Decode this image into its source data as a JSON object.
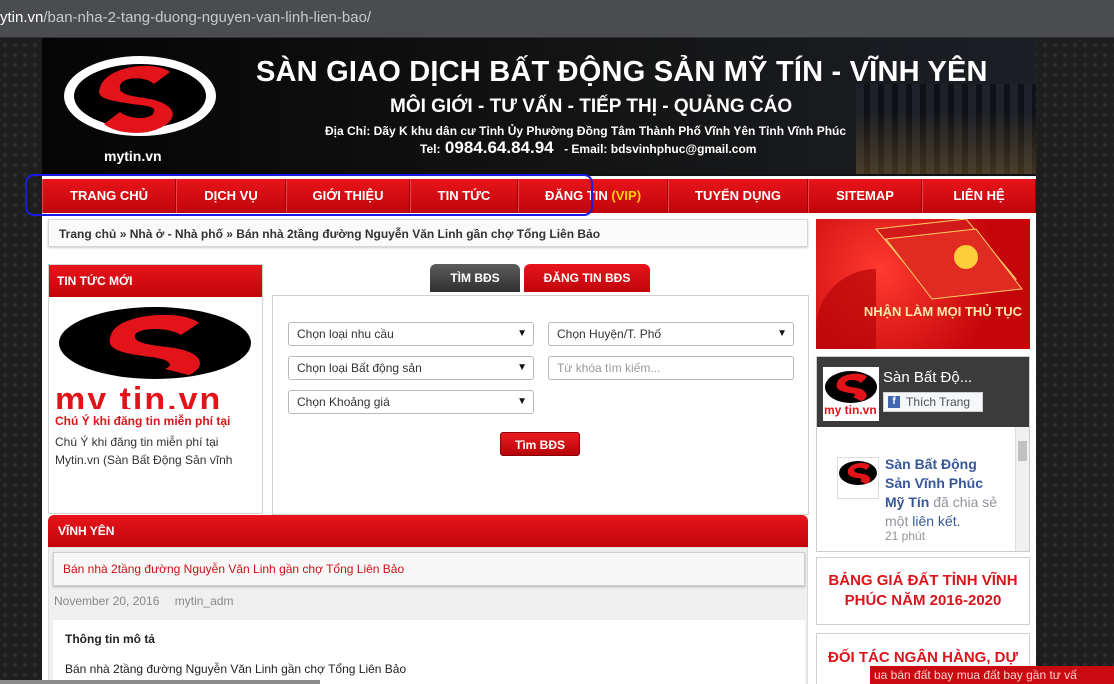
{
  "browser": {
    "url_host": "ytin.vn",
    "url_path": "/ban-nha-2-tang-duong-nguyen-van-linh-lien-bao/"
  },
  "banner": {
    "logo_text": "mytin.vn",
    "title": "SÀN GIAO DỊCH BẤT ĐỘNG SẢN MỸ TÍN - VĨNH YÊN",
    "subtitle": "MÔI GIỚI - TƯ VẤN - TIẾP THỊ - QUẢNG CÁO",
    "address": "Địa Chỉ: Dãy K khu dân cư Tỉnh Ủy Phường Đồng Tâm Thành Phố Vĩnh Yên Tỉnh Vĩnh Phúc",
    "tel_label": "Tel:",
    "phone": "0984.64.84.94",
    "email": "- Email: bdsvinhphuc@gmail.com"
  },
  "nav": {
    "items": [
      {
        "label": "TRANG CHỦ"
      },
      {
        "label": "DỊCH VỤ"
      },
      {
        "label": "GIỚI THIỆU"
      },
      {
        "label": "TIN TỨC"
      },
      {
        "label": "ĐĂNG TIN",
        "suffix": "(VIP)"
      },
      {
        "label": "TUYỂN DỤNG"
      },
      {
        "label": "SITEMAP"
      },
      {
        "label": "LIÊN HỆ"
      }
    ]
  },
  "breadcrumb": {
    "home": "Trang chủ",
    "sep": "»",
    "category": "Nhà ở - Nhà phố",
    "current": "Bán nhà 2tầng đường Nguyễn Văn Linh gần chợ Tổng Liên Bảo"
  },
  "news_box": {
    "heading": "TIN TỨC MỚI",
    "image_text": "my tin.vn",
    "item_title": "Chú Ý khi đăng tin miễn phí tại",
    "item_desc": "Chú Ý khi đăng tin miễn phí tại Mytin.vn (Sàn Bất Động Sản vĩnh"
  },
  "search": {
    "tab_search": "TÌM BĐS",
    "tab_post": "ĐĂNG TIN BĐS",
    "need": "Chọn loại nhu cầu",
    "district": "Chọn Huyện/T. Phố",
    "type": "Chọn loại Bất động sản",
    "keyword_placeholder": "Từ khóa tìm kiếm...",
    "price": "Chọn Khoảng giá",
    "button": "Tìm BĐS"
  },
  "section": {
    "heading": "VĨNH YÊN",
    "post_title": "Bán nhà 2tầng đường Nguyễn Văn Linh gần chợ Tổng Liên Bảo",
    "date": "November 20, 2016",
    "author": "mytin_adm",
    "desc_heading": "Thông tin mô tả",
    "desc_text": "Bán nhà 2tầng đường Nguyễn Văn Linh gần chợ Tổng Liên Bảo"
  },
  "right": {
    "ad_text": "NHẬN LÀM MỌI THỦ TỤC",
    "fb_page_name": "Sàn Bất Độ...",
    "fb_like": "Thích Trang",
    "fb_thumb_text": "my tin.vn",
    "fb_post_name": "Sàn Bất Động Sản Vĩnh Phúc Mỹ Tín",
    "fb_post_action": "đã chia sẻ một",
    "fb_post_link": "liên kết.",
    "fb_post_time": "21 phút",
    "box1": "BẢNG GIÁ ĐẤT TỈNH VĨNH PHÚC NĂM 2016-2020",
    "box2": "ĐỐI TÁC NGÂN HÀNG, DỰ ÁN BẤ"
  },
  "overlay": {
    "red_text": "ua bán đất bay mua đất bay gần tư vấ"
  },
  "colors": {
    "brand_red": "#d9141a",
    "nav_red": "#e8141b",
    "highlight_blue": "#1a1ae0",
    "fb_blue": "#365899"
  }
}
